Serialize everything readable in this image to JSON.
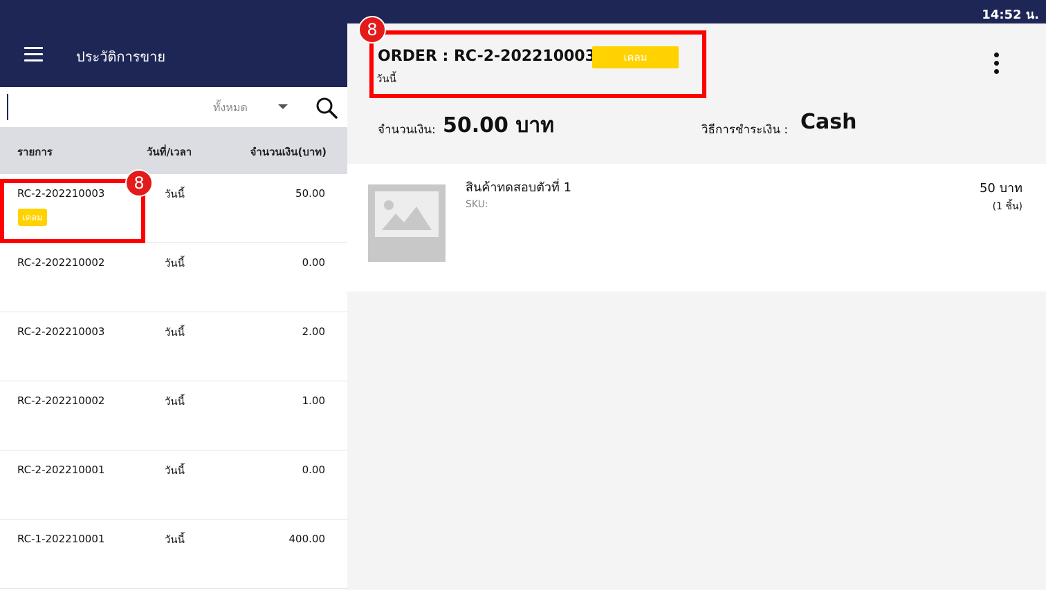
{
  "status_bar": {
    "time": "14:52 น."
  },
  "header": {
    "title": "ประวัติการขาย"
  },
  "search": {
    "placeholder": "",
    "filter_selected": "ทั้งหมด"
  },
  "table": {
    "columns": [
      "รายการ",
      "วันที่/เวลา",
      "จำนวนเงิน(บาท)"
    ],
    "rows": [
      {
        "id": "RC-2-202210003",
        "date": "วันนี้",
        "amount": "50.00",
        "badge": "เคลม"
      },
      {
        "id": "RC-2-202210002",
        "date": "วันนี้",
        "amount": "0.00",
        "badge": ""
      },
      {
        "id": "RC-2-202210003",
        "date": "วันนี้",
        "amount": "2.00",
        "badge": ""
      },
      {
        "id": "RC-2-202210002",
        "date": "วันนี้",
        "amount": "1.00",
        "badge": ""
      },
      {
        "id": "RC-2-202210001",
        "date": "วันนี้",
        "amount": "0.00",
        "badge": ""
      },
      {
        "id": "RC-1-202210001",
        "date": "วันนี้",
        "amount": "400.00",
        "badge": ""
      }
    ]
  },
  "annotations": {
    "marker_left": "8",
    "marker_right": "8"
  },
  "detail": {
    "order_title": "ORDER : RC-2-202210003",
    "badge": "เคลม",
    "date": "วันนี้",
    "amount_label": "จำนวนเงิน:",
    "amount_value": "50.00 บาท",
    "payment_label": "วิธีการชำระเงิน :",
    "payment_value": "Cash",
    "item": {
      "name": "สินค้าทดสอบตัวที่ 1",
      "sku": "SKU:",
      "price": "50 บาท",
      "qty": "(1 ชิ้น)"
    }
  },
  "colors": {
    "header_bg": "#1e2656",
    "badge": "#ffd200",
    "highlight": "#ff0000",
    "marker": "#e31b1b"
  },
  "icons": {
    "menu": "hamburger-icon",
    "search": "search-icon",
    "dropdown": "chevron-down-icon",
    "more": "more-vertical-icon",
    "image": "image-placeholder-icon"
  }
}
